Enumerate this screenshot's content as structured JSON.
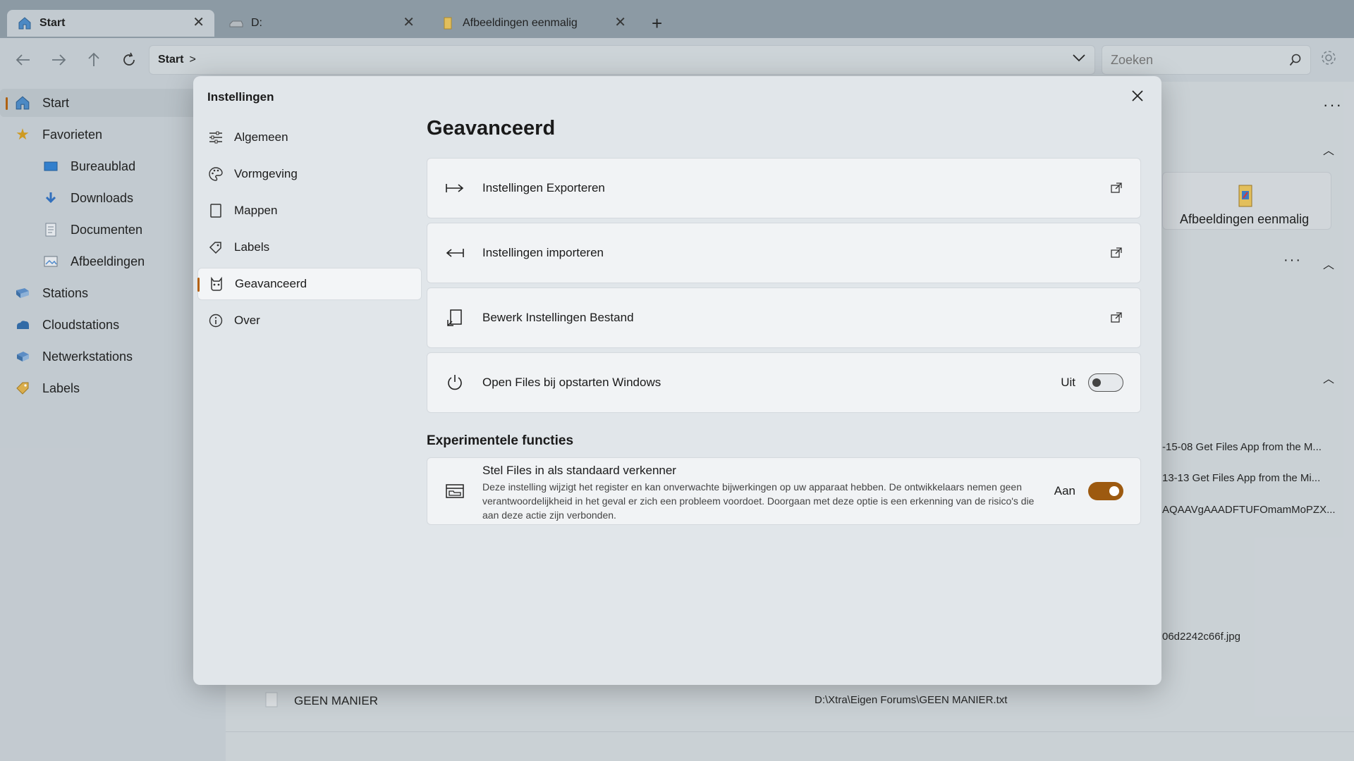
{
  "tabs": [
    {
      "label": "Start",
      "icon": "home-icon",
      "active": true
    },
    {
      "label": "D:",
      "icon": "drive-icon",
      "active": false
    },
    {
      "label": "Afbeeldingen  eenmalig",
      "icon": "folder-icon",
      "active": false
    }
  ],
  "address": {
    "crumb": "Start",
    "separator": ">"
  },
  "search": {
    "placeholder": "Zoeken"
  },
  "sidebar": {
    "items": [
      {
        "label": "Start",
        "icon": "home-icon",
        "selected": true
      },
      {
        "label": "Favorieten",
        "icon": "star-icon"
      },
      {
        "label": "Bureaublad",
        "icon": "desktop-icon"
      },
      {
        "label": "Downloads",
        "icon": "download-icon"
      },
      {
        "label": "Documenten",
        "icon": "document-icon"
      },
      {
        "label": "Afbeeldingen",
        "icon": "pictures-icon"
      },
      {
        "label": "Stations",
        "icon": "drives-icon"
      },
      {
        "label": "Cloudstations",
        "icon": "cloud-drive-icon"
      },
      {
        "label": "Netwerkstations",
        "icon": "network-icon"
      },
      {
        "label": "Labels",
        "icon": "tag-icon"
      }
    ]
  },
  "background": {
    "card_label": "Afbeeldingen  eenmalig",
    "recent": [
      "-15-08 Get Files App from the M...",
      "13-13 Get Files App from the Mi...",
      "AQAAVgAAADFTUFOmamMoPZX...",
      "06d2242c66f.jpg"
    ],
    "bottom_row": {
      "name": "GEEN MANIER",
      "path": "D:\\Xtra\\Eigen Forums\\GEEN MANIER.txt"
    }
  },
  "dialog": {
    "title": "Instellingen",
    "nav": [
      {
        "label": "Algemeen",
        "icon": "sliders-icon"
      },
      {
        "label": "Vormgeving",
        "icon": "palette-icon"
      },
      {
        "label": "Mappen",
        "icon": "folder-outline-icon"
      },
      {
        "label": "Labels",
        "icon": "tag-outline-icon"
      },
      {
        "label": "Geavanceerd",
        "icon": "advanced-icon",
        "selected": true
      },
      {
        "label": "Over",
        "icon": "info-icon"
      }
    ],
    "page_title": "Geavanceerd",
    "cards": {
      "export": "Instellingen Exporteren",
      "import": "Instellingen importeren",
      "edit": "Bewerk Instellingen Bestand",
      "startup": {
        "label": "Open Files bij opstarten Windows",
        "state": "Uit",
        "on": false
      }
    },
    "experimental": {
      "section_title": "Experimentele functies",
      "title": "Stel Files in als standaard verkenner",
      "description": "Deze instelling wijzigt het register en kan onverwachte bijwerkingen op uw apparaat hebben. De ontwikkelaars nemen geen verantwoordelijkheid in het geval er zich een probleem voordoet. Doorgaan met deze optie is een erkenning van de risico's die aan deze actie zijn verbonden.",
      "state": "Aan",
      "on": true
    }
  },
  "colors": {
    "accent": "#b3600c",
    "toggle_on": "#9d5a10"
  }
}
